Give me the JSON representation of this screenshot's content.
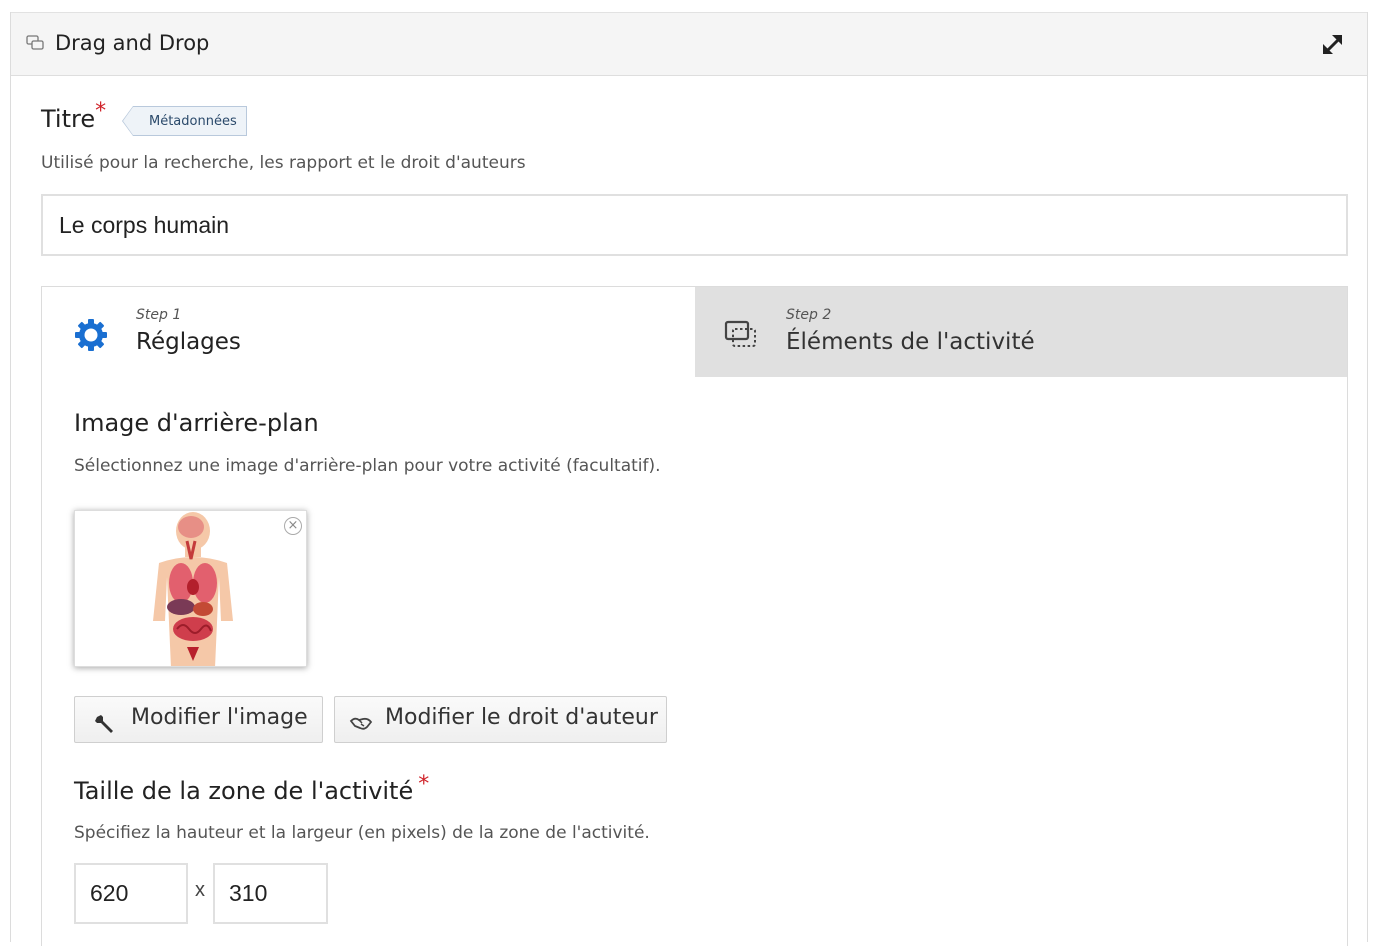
{
  "header": {
    "title": "Drag and Drop",
    "icon": "chat-bubbles-icon",
    "expand_icon": "expand-arrows-icon"
  },
  "title_field": {
    "label": "Titre",
    "required_mark": "*",
    "metadata_tag": "Métadonnées",
    "description": "Utilisé pour la recherche, les rapport et le droit d'auteurs",
    "value": "Le corps humain"
  },
  "steps": [
    {
      "number": "Step 1",
      "name": "Réglages",
      "icon": "gear-icon",
      "active": true
    },
    {
      "number": "Step 2",
      "name": "Éléments de l'activité",
      "icon": "elements-icon",
      "active": false
    }
  ],
  "background_image": {
    "title": "Image d'arrière-plan",
    "description": "Sélectionnez une image d'arrière-plan pour votre activité (facultatif).",
    "remove_symbol": "×",
    "edit_button": "Modifier l'image",
    "copyright_button": "Modifier le droit d'auteur"
  },
  "activity_size": {
    "title": "Taille de la zone de l'activité",
    "required_mark": "*",
    "description": "Spécifiez la hauteur et la largeur (en pixels) de la zone de l'activité.",
    "width": "620",
    "separator": "x",
    "height": "310"
  },
  "colors": {
    "accent_blue": "#1a6fd1",
    "required_red": "#d0232a",
    "inactive_tab": "#e0e0e0"
  }
}
